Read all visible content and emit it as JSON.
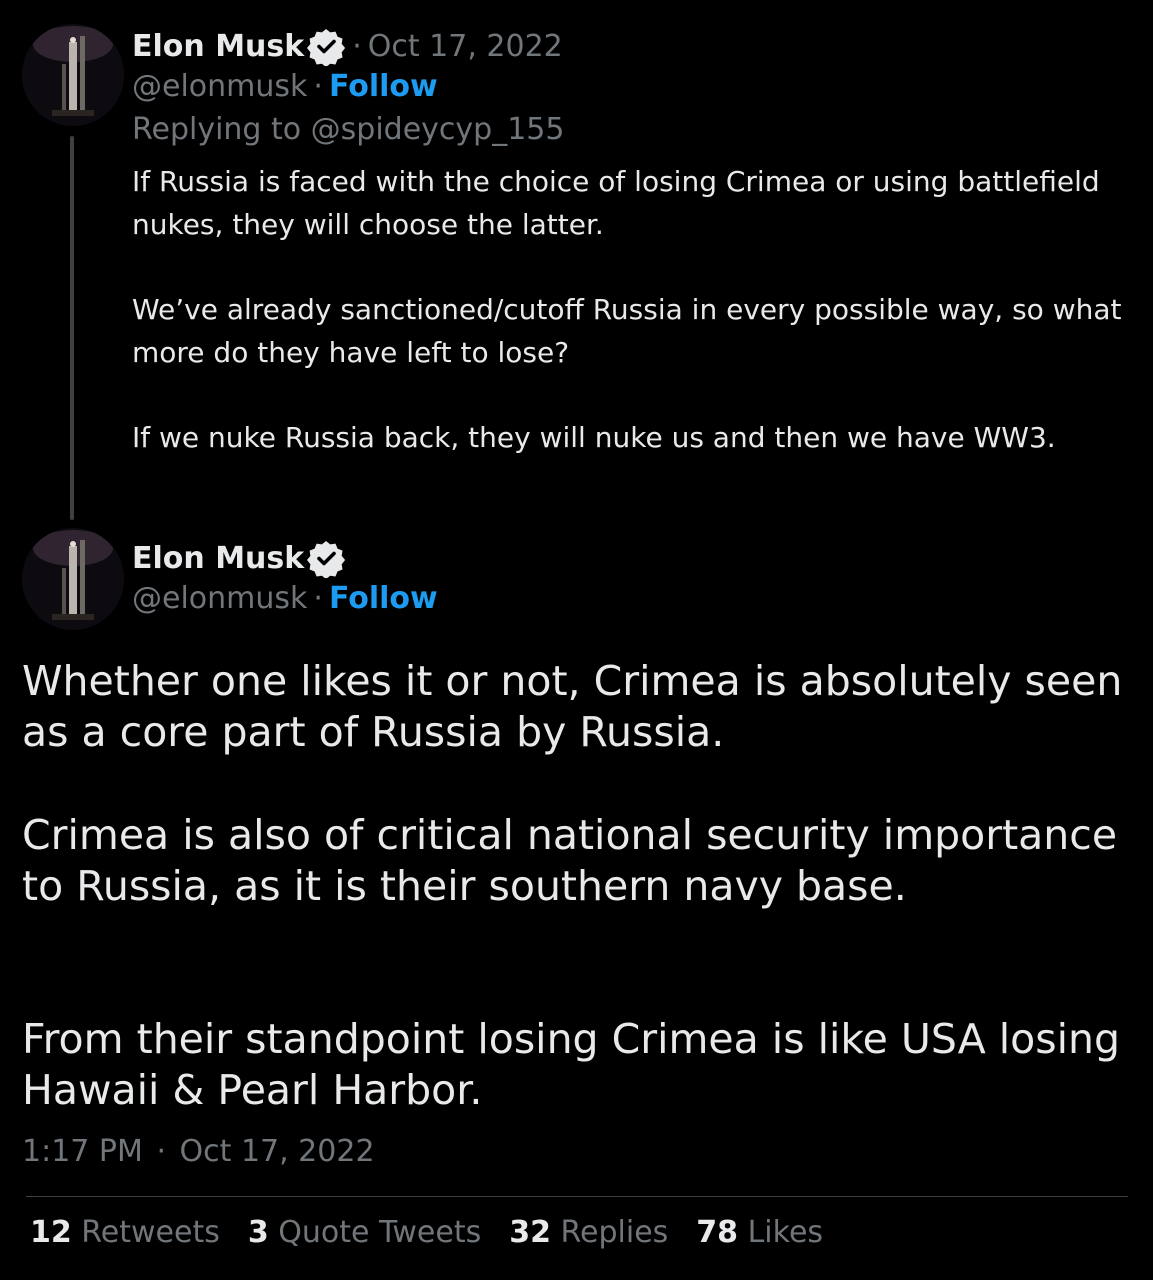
{
  "colors": {
    "background": "#000000",
    "text": "#e7e9ea",
    "muted": "#71767b",
    "link": "#1d9bf0",
    "thread_line": "#3e4144"
  },
  "parent_tweet": {
    "author_name": "Elon Musk",
    "handle": "@elonmusk",
    "separator": "·",
    "follow_label": "Follow",
    "date": "Oct 17, 2022",
    "reply_prefix": "Replying to ",
    "reply_to": "@spideycyp_155",
    "avatar_icon": "rocket-avatar-icon",
    "verified_icon": "verified-badge-icon",
    "paragraphs": [
      "If Russia is faced with the choice of losing Crimea or using battlefield nukes, they will choose the latter.",
      "We’ve already sanctioned/cutoff Russia in every possible way, so what more do they have left to lose?",
      "If we nuke Russia back, they will nuke us and then we have WW3."
    ]
  },
  "main_tweet": {
    "author_name": "Elon Musk",
    "handle": "@elonmusk",
    "separator": "·",
    "follow_label": "Follow",
    "avatar_icon": "rocket-avatar-icon",
    "verified_icon": "verified-badge-icon",
    "paragraphs": [
      "Whether one likes it or not, Crimea is absolutely seen as a core part of Russia by Russia.",
      "Crimea is also of critical national security importance to Russia, as it is their southern navy base.",
      "From their standpoint losing Crimea is like USA losing Hawaii & Pearl Harbor."
    ],
    "time": "1:17 PM",
    "date": "Oct 17, 2022"
  },
  "stats": [
    {
      "count": "12",
      "label": "Retweets"
    },
    {
      "count": "3",
      "label": "Quote Tweets"
    },
    {
      "count": "32",
      "label": "Replies"
    },
    {
      "count": "78",
      "label": "Likes"
    }
  ]
}
